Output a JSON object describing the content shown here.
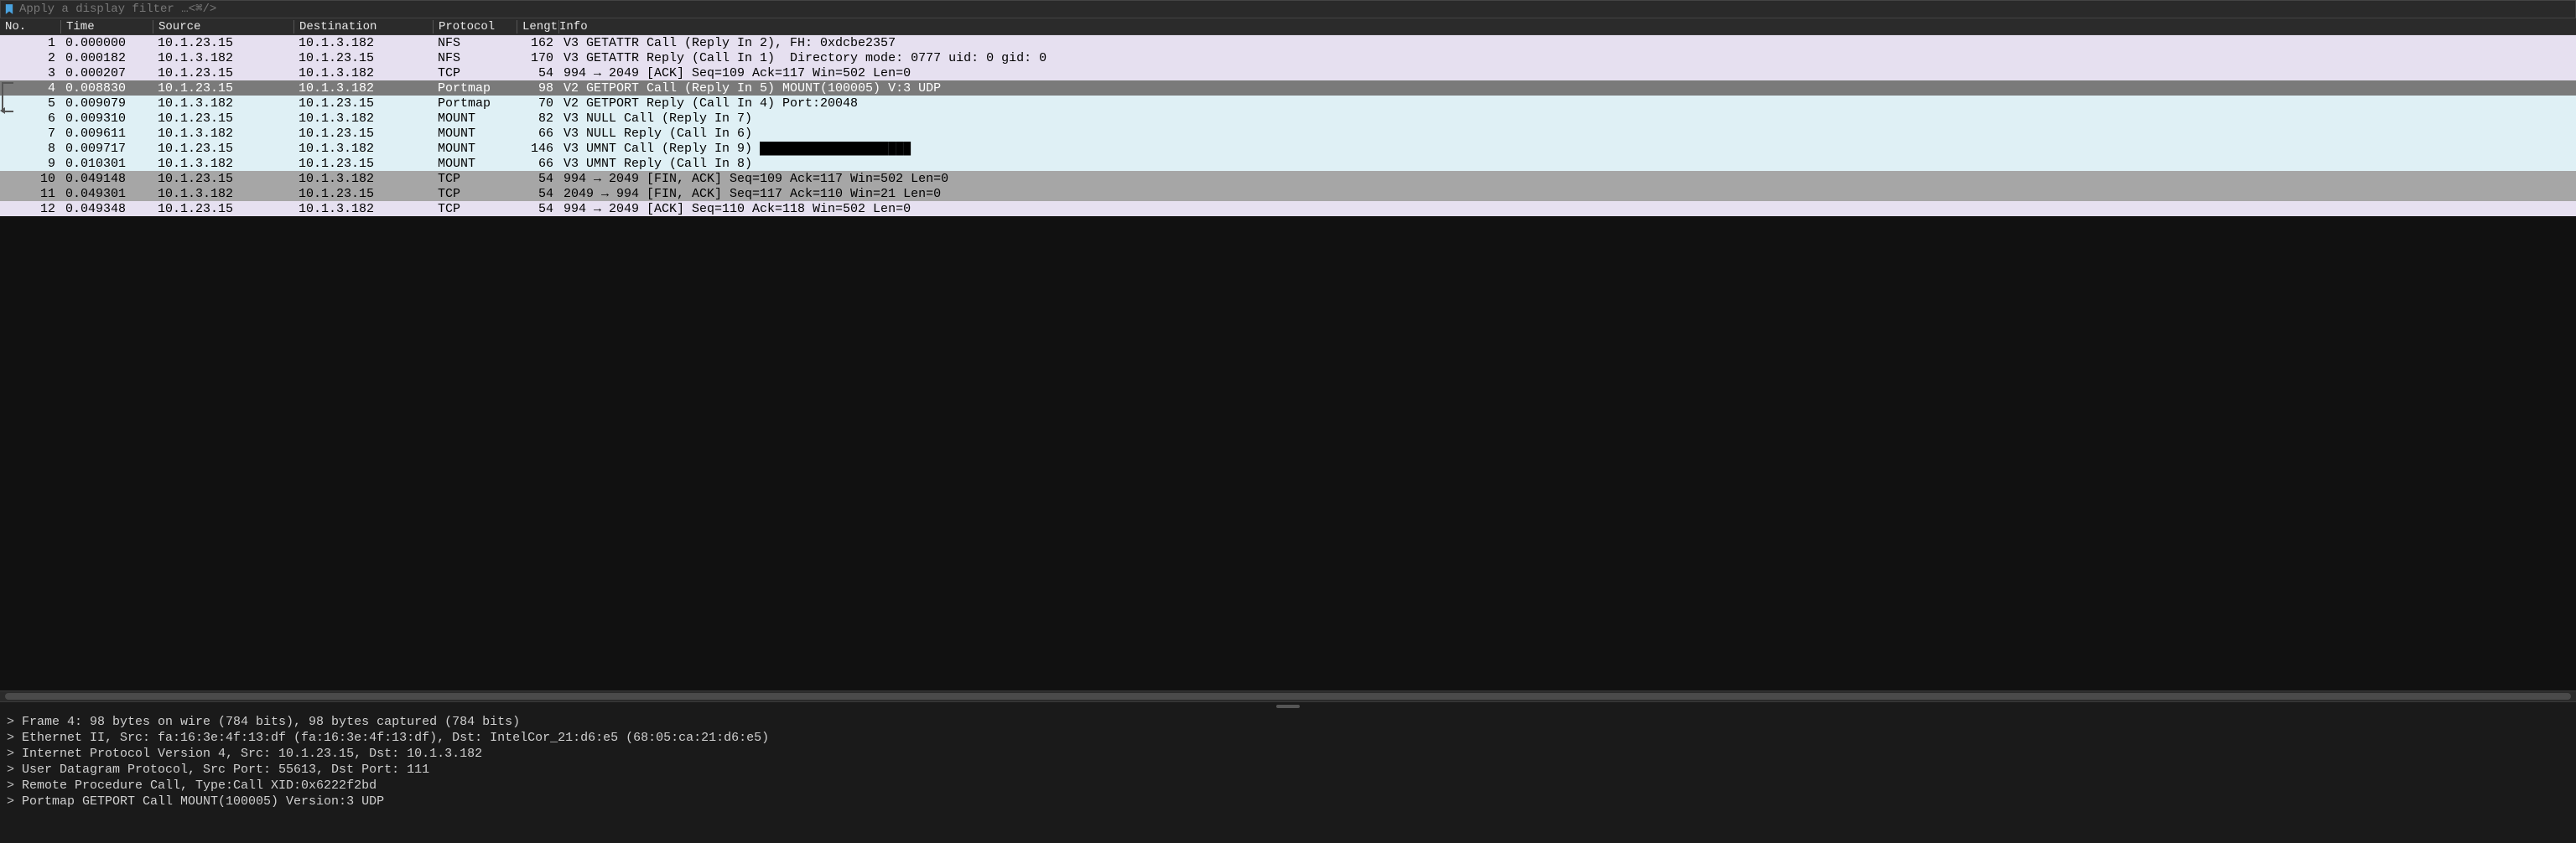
{
  "filter": {
    "placeholder": "Apply a display filter …<⌘/>"
  },
  "columns": {
    "no": "No.",
    "time": "Time",
    "source": "Source",
    "destination": "Destination",
    "protocol": "Protocol",
    "length": "Length",
    "info": "Info"
  },
  "packets": [
    {
      "no": "1",
      "time": "0.000000",
      "src": "10.1.23.15",
      "dst": "10.1.3.182",
      "proto": "NFS",
      "len": "162",
      "info": "V3 GETATTR Call (Reply In 2), FH: 0xdcbe2357",
      "cls": "bg-lav"
    },
    {
      "no": "2",
      "time": "0.000182",
      "src": "10.1.3.182",
      "dst": "10.1.23.15",
      "proto": "NFS",
      "len": "170",
      "info": "V3 GETATTR Reply (Call In 1)  Directory mode: 0777 uid: 0 gid: 0",
      "cls": "bg-lav"
    },
    {
      "no": "3",
      "time": "0.000207",
      "src": "10.1.23.15",
      "dst": "10.1.3.182",
      "proto": "TCP",
      "len": "54",
      "info": "994 → 2049 [ACK] Seq=109 Ack=117 Win=502 Len=0",
      "cls": "bg-lav"
    },
    {
      "no": "4",
      "time": "0.008830",
      "src": "10.1.23.15",
      "dst": "10.1.3.182",
      "proto": "Portmap",
      "len": "98",
      "info": "V2 GETPORT Call (Reply In 5) MOUNT(100005) V:3 UDP",
      "cls": "bg-sel"
    },
    {
      "no": "5",
      "time": "0.009079",
      "src": "10.1.3.182",
      "dst": "10.1.23.15",
      "proto": "Portmap",
      "len": "70",
      "info": "V2 GETPORT Reply (Call In 4) Port:20048",
      "cls": "bg-blue"
    },
    {
      "no": "6",
      "time": "0.009310",
      "src": "10.1.23.15",
      "dst": "10.1.3.182",
      "proto": "MOUNT",
      "len": "82",
      "info": "V3 NULL Call (Reply In 7)",
      "cls": "bg-blue"
    },
    {
      "no": "7",
      "time": "0.009611",
      "src": "10.1.3.182",
      "dst": "10.1.23.15",
      "proto": "MOUNT",
      "len": "66",
      "info": "V3 NULL Reply (Call In 6)",
      "cls": "bg-blue"
    },
    {
      "no": "8",
      "time": "0.009717",
      "src": "10.1.23.15",
      "dst": "10.1.3.182",
      "proto": "MOUNT",
      "len": "146",
      "info": "V3 UMNT Call (Reply In 9) ████████████████████",
      "cls": "bg-blue"
    },
    {
      "no": "9",
      "time": "0.010301",
      "src": "10.1.3.182",
      "dst": "10.1.23.15",
      "proto": "MOUNT",
      "len": "66",
      "info": "V3 UMNT Reply (Call In 8)",
      "cls": "bg-blue"
    },
    {
      "no": "10",
      "time": "0.049148",
      "src": "10.1.23.15",
      "dst": "10.1.3.182",
      "proto": "TCP",
      "len": "54",
      "info": "994 → 2049 [FIN, ACK] Seq=109 Ack=117 Win=502 Len=0",
      "cls": "bg-grey"
    },
    {
      "no": "11",
      "time": "0.049301",
      "src": "10.1.3.182",
      "dst": "10.1.23.15",
      "proto": "TCP",
      "len": "54",
      "info": "2049 → 994 [FIN, ACK] Seq=117 Ack=110 Win=21 Len=0",
      "cls": "bg-grey"
    },
    {
      "no": "12",
      "time": "0.049348",
      "src": "10.1.23.15",
      "dst": "10.1.3.182",
      "proto": "TCP",
      "len": "54",
      "info": "994 → 2049 [ACK] Seq=110 Ack=118 Win=502 Len=0",
      "cls": "bg-lav"
    }
  ],
  "tree": [
    "Frame 4: 98 bytes on wire (784 bits), 98 bytes captured (784 bits)",
    "Ethernet II, Src: fa:16:3e:4f:13:df (fa:16:3e:4f:13:df), Dst: IntelCor_21:d6:e5 (68:05:ca:21:d6:e5)",
    "Internet Protocol Version 4, Src: 10.1.23.15, Dst: 10.1.3.182",
    "User Datagram Protocol, Src Port: 55613, Dst Port: 111",
    "Remote Procedure Call, Type:Call XID:0x6222f2bd",
    "Portmap GETPORT Call MOUNT(100005) Version:3 UDP"
  ],
  "glyphs": {
    "chevron": ">"
  }
}
